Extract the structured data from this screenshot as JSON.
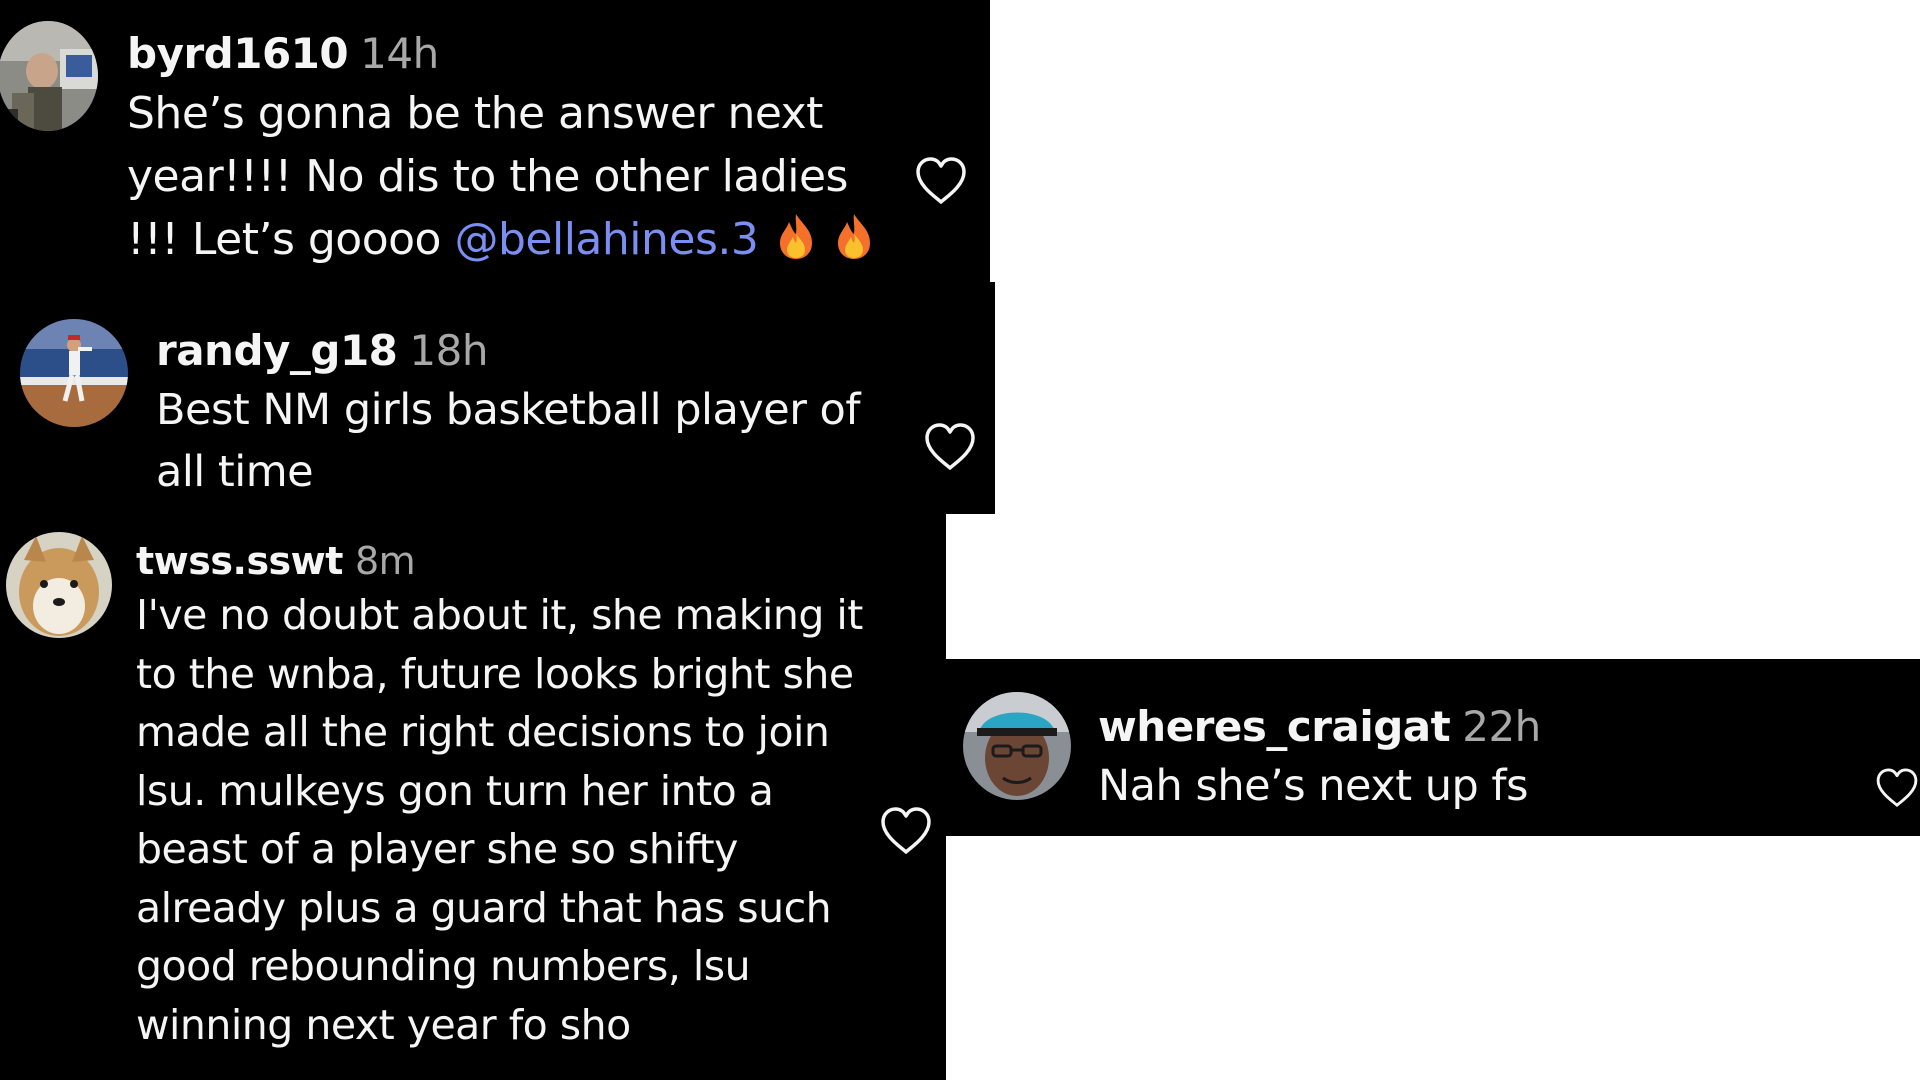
{
  "comments": [
    {
      "username": "byrd1610",
      "time": "14h",
      "text": "She’s gonna be the answer next year!!!! No dis to the other ladies !!! Let’s goooo ",
      "mention": "@bellahines.3",
      "emoji": [
        "fire-icon",
        "fire-icon"
      ]
    },
    {
      "username": "randy_g18",
      "time": "18h",
      "text": "Best NM girls basketball player of all time"
    },
    {
      "username": "twss.sswt",
      "time": "8m",
      "text": "I've no doubt about it, she making it to the wnba, future looks bright she made all the right decisions to join lsu. mulkeys gon turn her into a beast of a player she so shifty already plus a guard that has such good rebounding numbers, lsu winning next year fo sho"
    },
    {
      "username": "wheres_craigat",
      "time": "22h",
      "text": "Nah she’s next up fs"
    }
  ],
  "colors": {
    "background": "#000000",
    "text": "#f5f5f5",
    "timestamp": "#a8a8a8",
    "mention": "#7b8ff2",
    "page": "#ffffff"
  },
  "icons": {
    "like": "heart-outline-icon",
    "emoji": "fire-icon"
  }
}
